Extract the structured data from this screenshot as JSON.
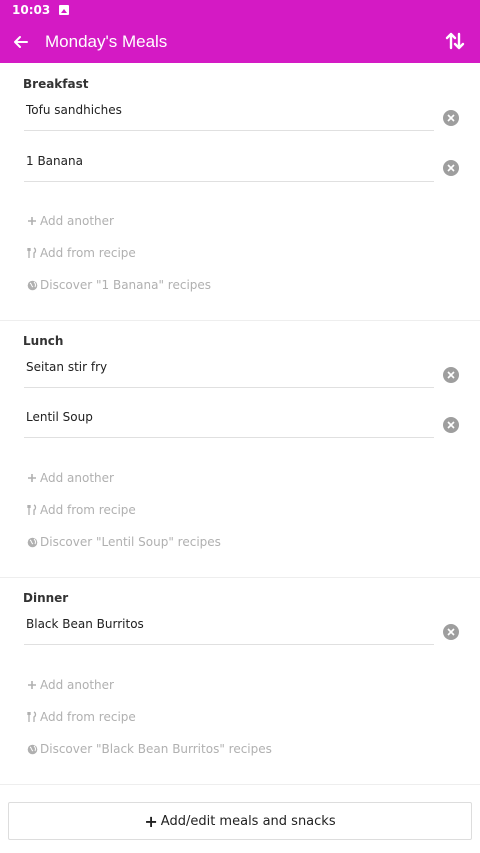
{
  "status_bar": {
    "time": "10:03"
  },
  "app_bar": {
    "title": "Monday's Meals"
  },
  "sections": [
    {
      "title": "Breakfast",
      "items": [
        "Tofu sandhiches",
        "1 Banana"
      ],
      "add_another": "Add another",
      "add_from_recipe": "Add from recipe",
      "discover": "Discover \"1 Banana\" recipes"
    },
    {
      "title": "Lunch",
      "items": [
        "Seitan stir fry",
        "Lentil Soup"
      ],
      "add_another": "Add another",
      "add_from_recipe": "Add from recipe",
      "discover": "Discover \"Lentil Soup\" recipes"
    },
    {
      "title": "Dinner",
      "items": [
        "Black Bean Burritos"
      ],
      "add_another": "Add another",
      "add_from_recipe": "Add from recipe",
      "discover": "Discover \"Black Bean Burritos\" recipes"
    }
  ],
  "footer": {
    "button_label": "Add/edit meals and snacks"
  },
  "icons": {
    "status_notification": "image-icon",
    "back": "arrow-left-icon",
    "sort": "sort-arrows-icon",
    "clear": "close-circle-icon",
    "add": "plus-icon",
    "recipe": "fork-knife-icon",
    "discover": "globe-icon"
  },
  "colors": {
    "app_bar": "#d41ac4",
    "link_text": "#b0b0b0",
    "clear_icon": "#9e9e9e"
  }
}
